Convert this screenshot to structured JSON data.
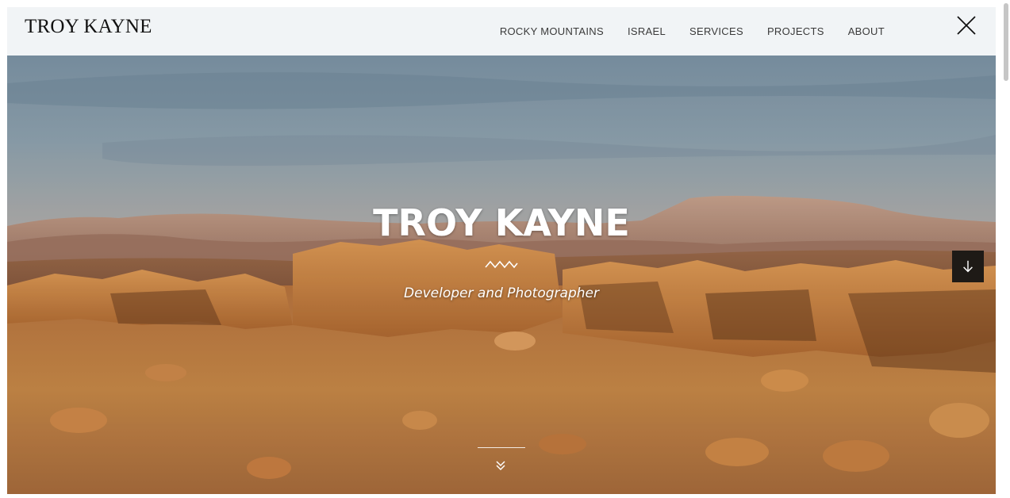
{
  "header": {
    "brand": "TROY KAYNE",
    "nav": [
      {
        "label": "ROCKY MOUNTAINS"
      },
      {
        "label": "ISRAEL"
      },
      {
        "label": "SERVICES"
      },
      {
        "label": "PROJECTS"
      },
      {
        "label": "ABOUT"
      }
    ],
    "close_icon": "close-icon"
  },
  "hero": {
    "title": "TROY KAYNE",
    "subtitle": "Developer and Photographer",
    "divider_icon": "wave-icon",
    "scroll_button_icon": "arrow-down-icon",
    "bottom_icon": "double-chevron-down-icon"
  },
  "colors": {
    "header_bg": "#f1f4f6",
    "scroll_button_bg": "#1e1a16",
    "hero_text": "#ffffff"
  }
}
